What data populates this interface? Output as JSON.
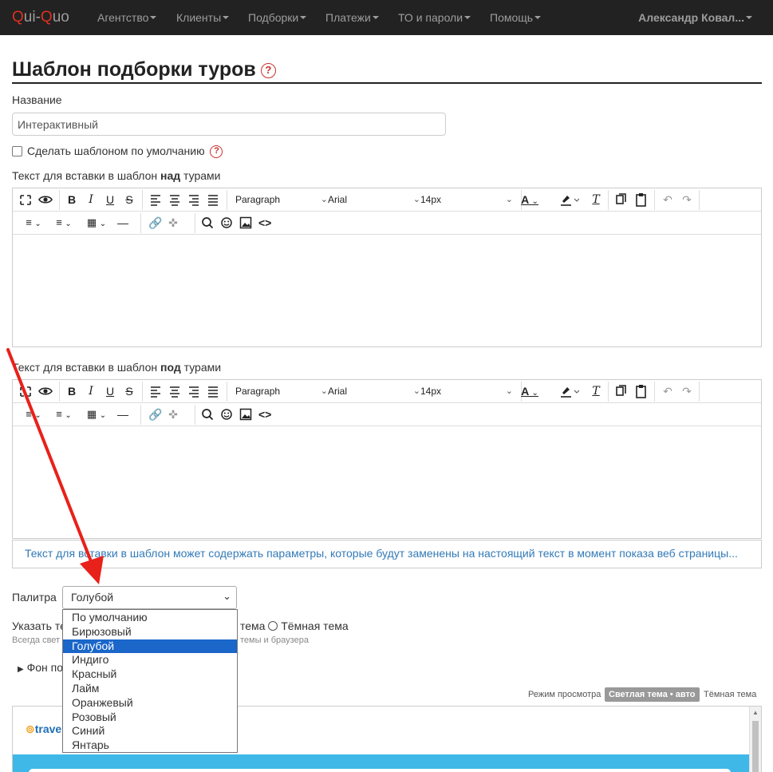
{
  "navbar": {
    "brand_q1": "Q",
    "brand_mid": "ui-",
    "brand_q2": "Q",
    "brand_end": "uo",
    "items": [
      "Агентство",
      "Клиенты",
      "Подборки",
      "Платежи",
      "ТО и пароли",
      "Помощь"
    ],
    "user": "Александр Ковал..."
  },
  "page": {
    "title": "Шаблон подборки туров",
    "name_label": "Название",
    "name_value": "Интерактивный",
    "default_checkbox_label": "Сделать шаблоном по умолчанию",
    "above_label_pre": "Текст для вставки в шаблон ",
    "above_label_bold": "над",
    "above_label_post": " турами",
    "below_label_pre": "Текст для вставки в шаблон ",
    "below_label_bold": "под",
    "below_label_post": " турами",
    "info_text": "Текст для вставки в шаблон может содержать параметры, которые будут заменены на настоящий текст в момент показа веб страницы..."
  },
  "editor_toolbar": {
    "block_format": "Paragraph",
    "font_family": "Arial",
    "font_size": "14px",
    "icons": [
      "fullscreen-icon",
      "preview-icon",
      "bold-icon",
      "italic-icon",
      "underline-icon",
      "strikethrough-icon",
      "align-left-icon",
      "align-center-icon",
      "align-right-icon",
      "justify-icon",
      "text-color-icon",
      "highlight-icon",
      "clear-format-icon",
      "copy-icon",
      "paste-icon",
      "undo-icon",
      "redo-icon",
      "numbered-list-icon",
      "bullet-list-icon",
      "table-icon",
      "horizontal-line-icon",
      "link-icon",
      "unlink-icon",
      "search-icon",
      "emoji-icon",
      "image-icon",
      "source-code-icon"
    ]
  },
  "palette": {
    "label": "Палитра",
    "selected": "Голубой",
    "options": [
      "По умолчанию",
      "Бирюзовый",
      "Голубой",
      "Индиго",
      "Красный",
      "Лайм",
      "Оранжевый",
      "Розовый",
      "Синий",
      "Янтарь"
    ]
  },
  "theme": {
    "label_visible": "Указать те",
    "option_middle": "тема",
    "option_dark": "Тёмная тема",
    "hint_visible_left": "Всегда свет",
    "hint_visible_right": "темы и браузера"
  },
  "background_toggle": "Фон по",
  "preview": {
    "mode_label": "Режим просмотра",
    "light_auto": "Светлая тема • авто",
    "dark": "Тёмная тема",
    "logo_text": "trave"
  },
  "colors": {
    "navbar_bg": "#222222",
    "accent_red": "#e0301e",
    "link_blue": "#337ab7",
    "selected_option": "#1a66c9",
    "annotation_arrow": "#e8211a"
  }
}
